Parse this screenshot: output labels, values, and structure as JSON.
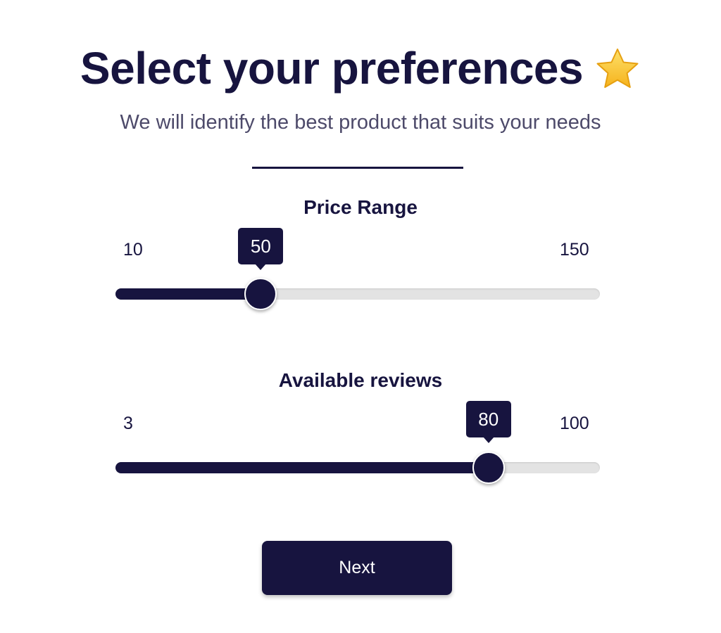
{
  "header": {
    "title": "Select your preferences",
    "title_icon": "star-icon",
    "subtitle": "We will identify the best product that suits your needs"
  },
  "sliders": [
    {
      "label": "Price Range",
      "min": "10",
      "max": "150",
      "value": "50",
      "fill_fraction": 0.3
    },
    {
      "label": "Available reviews",
      "min": "3",
      "max": "100",
      "value": "80",
      "fill_fraction": 0.77
    }
  ],
  "actions": {
    "next_label": "Next"
  },
  "colors": {
    "primary": "#17143f",
    "track": "#e3e3e3",
    "subtitle": "#4d4a6a",
    "star": "#f9c62d"
  }
}
